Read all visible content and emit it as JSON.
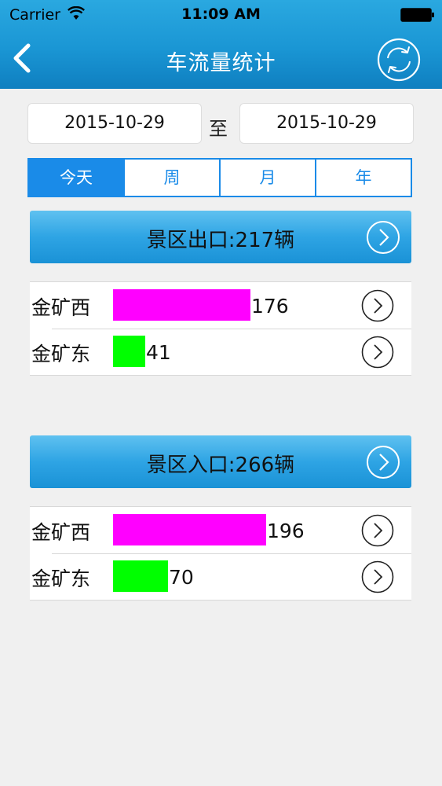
{
  "status": {
    "carrier": "Carrier",
    "time": "11:09 AM"
  },
  "nav": {
    "title": "车流量统计"
  },
  "date_range": {
    "start": "2015-10-29",
    "separator": "至",
    "end": "2015-10-29"
  },
  "tabs": [
    {
      "label": "今天",
      "active": true
    },
    {
      "label": "周",
      "active": false
    },
    {
      "label": "月",
      "active": false
    },
    {
      "label": "年",
      "active": false
    }
  ],
  "colors": {
    "accent": "#1a8be8",
    "bar_primary": "#ff00ff",
    "bar_secondary": "#00ff00"
  },
  "sections": [
    {
      "title": "景区出口:217辆",
      "rows": [
        {
          "name": "金矿西",
          "value": 176,
          "color": "#ff00ff"
        },
        {
          "name": "金矿东",
          "value": 41,
          "color": "#00ff00"
        }
      ]
    },
    {
      "title": "景区入口:266辆",
      "rows": [
        {
          "name": "金矿西",
          "value": 196,
          "color": "#ff00ff"
        },
        {
          "name": "金矿东",
          "value": 70,
          "color": "#00ff00"
        }
      ]
    }
  ]
}
